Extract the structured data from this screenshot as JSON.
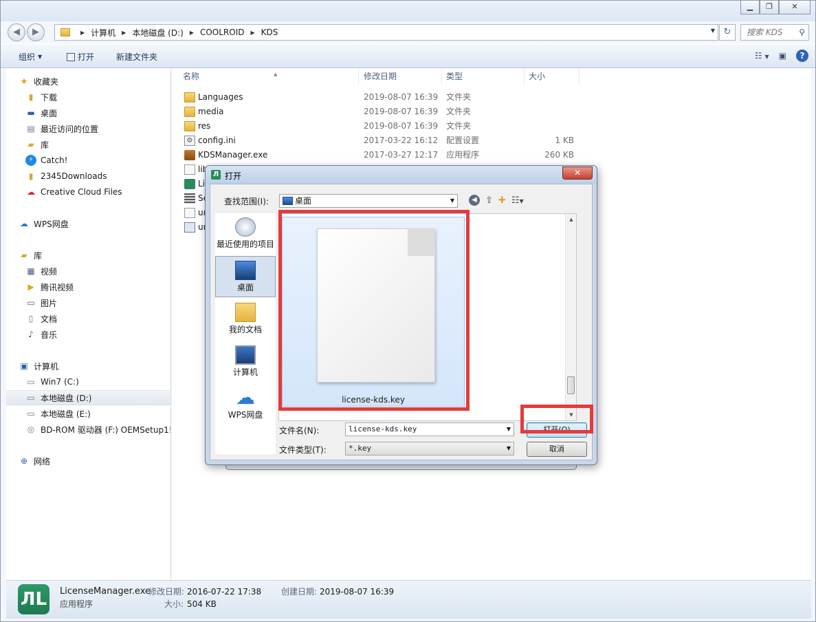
{
  "explorer": {
    "breadcrumbs": [
      "计算机",
      "本地磁盘 (D:)",
      "COOLROID",
      "KDS"
    ],
    "search_placeholder": "搜索 KDS",
    "toolbar": {
      "organize": "组织",
      "open": "打开",
      "new_folder": "新建文件夹"
    },
    "nav": {
      "favorites": "收藏夹",
      "fav_items": [
        "下载",
        "桌面",
        "最近访问的位置",
        "库",
        "Catch!",
        "2345Downloads",
        "Creative Cloud Files"
      ],
      "wps": "WPS网盘",
      "library": "库",
      "lib_items": [
        "视频",
        "腾讯视频",
        "图片",
        "文档",
        "音乐"
      ],
      "computer": "计算机",
      "computer_items": [
        "Win7 (C:)",
        "本地磁盘 (D:)",
        "本地磁盘 (E:)",
        "BD-ROM 驱动器 (F:) OEMSetup1!"
      ],
      "network": "网络"
    },
    "columns": {
      "name": "名称",
      "modified": "修改日期",
      "type": "类型",
      "size": "大小"
    },
    "files": [
      {
        "name": "Languages",
        "modified": "2019-08-07 16:39",
        "type": "文件夹",
        "size": ""
      },
      {
        "name": "media",
        "modified": "2019-08-07 16:39",
        "type": "文件夹",
        "size": ""
      },
      {
        "name": "res",
        "modified": "2019-08-07 16:39",
        "type": "文件夹",
        "size": ""
      },
      {
        "name": "config.ini",
        "modified": "2017-03-22 16:12",
        "type": "配置设置",
        "size": "1 KB"
      },
      {
        "name": "KDSManager.exe",
        "modified": "2017-03-27 12:17",
        "type": "应用程序",
        "size": "260 KB"
      },
      {
        "name": "lib",
        "modified": "",
        "type": "",
        "size": ""
      },
      {
        "name": "Li",
        "modified": "",
        "type": "",
        "size": ""
      },
      {
        "name": "Se",
        "modified": "",
        "type": "",
        "size": ""
      },
      {
        "name": "ur",
        "modified": "",
        "type": "",
        "size": ""
      },
      {
        "name": "ur",
        "modified": "",
        "type": "",
        "size": ""
      }
    ],
    "details": {
      "filename": "LicenseManager.exe",
      "file_type": "应用程序",
      "modified_label": "修改日期:",
      "modified": "2016-07-22 17:38",
      "created_label": "创建日期:",
      "created": "2019-08-07 16:39",
      "size_label": "大小:",
      "size": "504 KB"
    }
  },
  "dialog": {
    "title": "打开",
    "look_in_label": "查找范围(I):",
    "look_in_value": "桌面",
    "places": [
      "最近使用的项目",
      "桌面",
      "我的文档",
      "计算机",
      "WPS网盘"
    ],
    "file_item": "license-kds.key",
    "filename_label": "文件名(N):",
    "filename_value": "license-kds.key",
    "filetype_label": "文件类型(T):",
    "filetype_value": "*.key",
    "open_button": "打开(O)",
    "cancel_button": "取消"
  },
  "colors": {
    "highlight": "#e43b3b",
    "selection": "#d4e6fb"
  }
}
